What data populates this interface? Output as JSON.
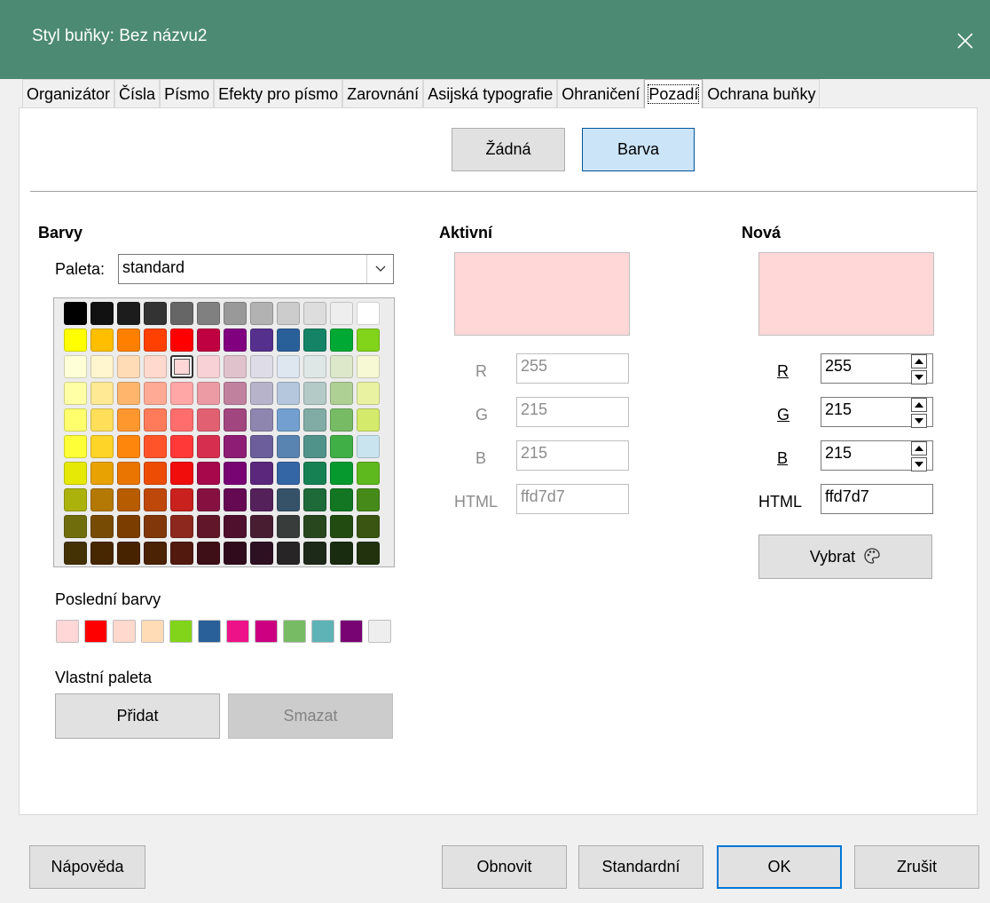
{
  "window": {
    "title": "Styl buňky: Bez názvu2"
  },
  "tabs": [
    "Organizátor",
    "Čísla",
    "Písmo",
    "Efekty pro písmo",
    "Zarovnání",
    "Asijská typografie",
    "Ohraničení",
    "Pozadí",
    "Ochrana buňky"
  ],
  "active_tab": "Pozadí",
  "mode_buttons": {
    "none": "Žádná",
    "color": "Barva"
  },
  "colors_section": {
    "heading": "Barvy",
    "palette_label": "Paleta:",
    "palette_value": "standard",
    "palette_grid": [
      [
        "#000000",
        "#111111",
        "#1c1c1c",
        "#333333",
        "#666666",
        "#808080",
        "#999999",
        "#b2b2b2",
        "#cccccc",
        "#dddddd",
        "#eeeeee",
        "#ffffff"
      ],
      [
        "#ffff00",
        "#ffbf00",
        "#ff8000",
        "#ff4000",
        "#ff0000",
        "#bf0041",
        "#800080",
        "#55308d",
        "#2a6099",
        "#158466",
        "#00a933",
        "#81d41a"
      ],
      [
        "#ffffd7",
        "#fff5ce",
        "#ffdbb6",
        "#ffd8ce",
        "#ffd7d7",
        "#f7d1d5",
        "#e0c2cd",
        "#dedce6",
        "#dee6ef",
        "#dee7e5",
        "#dde8cb",
        "#f6f9d4"
      ],
      [
        "#ffffa6",
        "#ffe994",
        "#ffb66c",
        "#ffaa95",
        "#ffa6a6",
        "#ec9ba4",
        "#bf819e",
        "#b7b3ca",
        "#b4c7dc",
        "#b3cac7",
        "#afd095",
        "#e8f2a1"
      ],
      [
        "#ffff6d",
        "#ffde59",
        "#ff972f",
        "#ff7b59",
        "#ff6d6d",
        "#e16173",
        "#a1467e",
        "#8e86ae",
        "#729fcf",
        "#81aca6",
        "#77bc65",
        "#d4ea6b"
      ],
      [
        "#ffff38",
        "#ffd428",
        "#ff860d",
        "#ff5429",
        "#ff3838",
        "#d62e4e",
        "#8d1d75",
        "#6b5e9b",
        "#5983b0",
        "#50938a",
        "#3faf46",
        "#c9e4ee"
      ],
      [
        "#e6e905",
        "#e8a202",
        "#ea7500",
        "#ed4c05",
        "#f10d0c",
        "#a7074b",
        "#780373",
        "#5b277d",
        "#3465a4",
        "#168253",
        "#069a2e",
        "#5eb91e"
      ],
      [
        "#acb20c",
        "#b47804",
        "#b85c00",
        "#be480a",
        "#c9211e",
        "#861141",
        "#650953",
        "#55215b",
        "#355269",
        "#1e6a39",
        "#127622",
        "#468a1a"
      ],
      [
        "#706e0c",
        "#784b04",
        "#7b3d00",
        "#813709",
        "#8d281e",
        "#611729",
        "#4e102d",
        "#481d32",
        "#383d3c",
        "#28471f",
        "#224b12",
        "#395511"
      ],
      [
        "#443205",
        "#472702",
        "#482300",
        "#4b2204",
        "#52190f",
        "#3e0f16",
        "#300b1c",
        "#2d1022",
        "#272526",
        "#1d2a1a",
        "#1a2c0f",
        "#22320c"
      ]
    ],
    "selected_color": "#ffd7d7",
    "recent_label": "Poslední barvy",
    "recent_colors": [
      "#ffd7d7",
      "#ff0000",
      "#ffd8ce",
      "#ffdbb6",
      "#81d41a",
      "#2a6099",
      "#ee1289",
      "#cc0080",
      "#77bc65",
      "#5eb3b6",
      "#780373",
      "#eeeeee"
    ],
    "custom_label": "Vlastní paleta",
    "add_button": "Přidat",
    "delete_button": "Smazat"
  },
  "active": {
    "heading": "Aktivní",
    "color": "#ffd7d7",
    "labels": {
      "r": "R",
      "g": "G",
      "b": "B",
      "html": "HTML"
    },
    "r": "255",
    "g": "215",
    "b": "215",
    "html": "ffd7d7"
  },
  "new": {
    "heading": "Nová",
    "color": "#ffd7d7",
    "labels": {
      "r": "R",
      "g": "G",
      "b": "B",
      "html": "HTML"
    },
    "r": "255",
    "g": "215",
    "b": "215",
    "html": "ffd7d7",
    "pick_button": "Vybrat"
  },
  "footer": {
    "help": "Nápověda",
    "reset": "Obnovit",
    "standard": "Standardní",
    "ok": "OK",
    "cancel": "Zrušit"
  },
  "colors": {
    "titlebar": "#4c8a73",
    "selected_button": "#cce4f7",
    "default_border": "#0078d7"
  }
}
